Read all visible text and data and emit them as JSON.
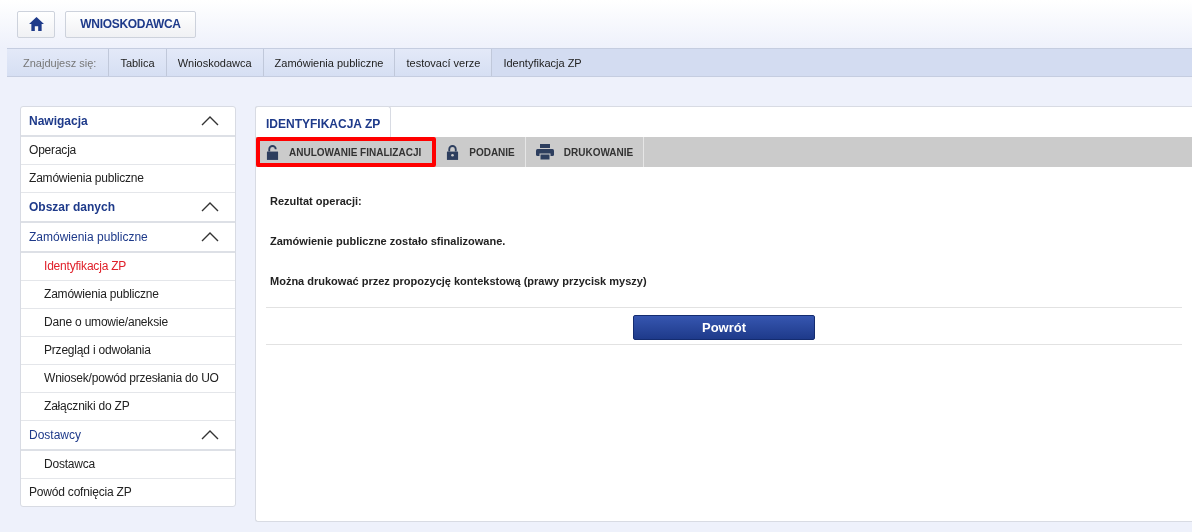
{
  "top_bar": {
    "role_button": "WNIOSKODAWCA"
  },
  "breadcrumb": {
    "label": "Znajdujesz się:",
    "items": [
      {
        "label": "Tablica",
        "selected": false
      },
      {
        "label": "Wnioskodawca",
        "selected": false
      },
      {
        "label": "Zamówienia publiczne",
        "selected": false
      },
      {
        "label": "testovací verze",
        "selected": false
      },
      {
        "label": "Identyfikacja ZP",
        "selected": true
      }
    ]
  },
  "sidebar": [
    {
      "kind": "section",
      "label": "Nawigacja",
      "expanded": true,
      "children": [
        {
          "kind": "link",
          "label": "Operacja",
          "selected": false
        },
        {
          "kind": "link",
          "label": "Zamówienia publiczne",
          "selected": false
        }
      ]
    },
    {
      "kind": "section",
      "label": "Obszar danych",
      "expanded": true,
      "children": [
        {
          "kind": "group",
          "label": "Zamówienia publiczne",
          "expanded": true,
          "children": [
            {
              "kind": "link",
              "label": "Identyfikacja ZP",
              "selected": true
            },
            {
              "kind": "link",
              "label": "Zamówienia publiczne",
              "selected": false
            },
            {
              "kind": "link",
              "label": "Dane o umowie/aneksie",
              "selected": false
            },
            {
              "kind": "link",
              "label": "Przegląd i odwołania",
              "selected": false
            },
            {
              "kind": "link",
              "label": "Wniosek/powód przesłania do UO",
              "selected": false
            },
            {
              "kind": "link",
              "label": "Załączniki do ZP",
              "selected": false
            }
          ]
        },
        {
          "kind": "group",
          "label": "Dostawcy",
          "expanded": true,
          "children": [
            {
              "kind": "link",
              "label": "Dostawca",
              "selected": false
            }
          ]
        },
        {
          "kind": "link",
          "label": "Powód cofnięcia ZP",
          "selected": false
        }
      ]
    }
  ],
  "tabs": [
    {
      "label": "IDENTYFIKACJA ZP",
      "selected": true
    }
  ],
  "toolbar": [
    {
      "kind": "unlock",
      "label": "ANULOWANIE FINALIZACJI",
      "highlighted": true
    },
    {
      "kind": "lock",
      "label": "PODANIE",
      "highlighted": false
    },
    {
      "kind": "print",
      "label": "DRUKOWANIE",
      "highlighted": false
    }
  ],
  "messages": [
    "Rezultat operacji:",
    "Zamówienie publiczne zostało sfinalizowane.",
    "Można drukować przez propozycję kontekstową (prawy przycisk myszy)"
  ],
  "back_button": "Powrót"
}
